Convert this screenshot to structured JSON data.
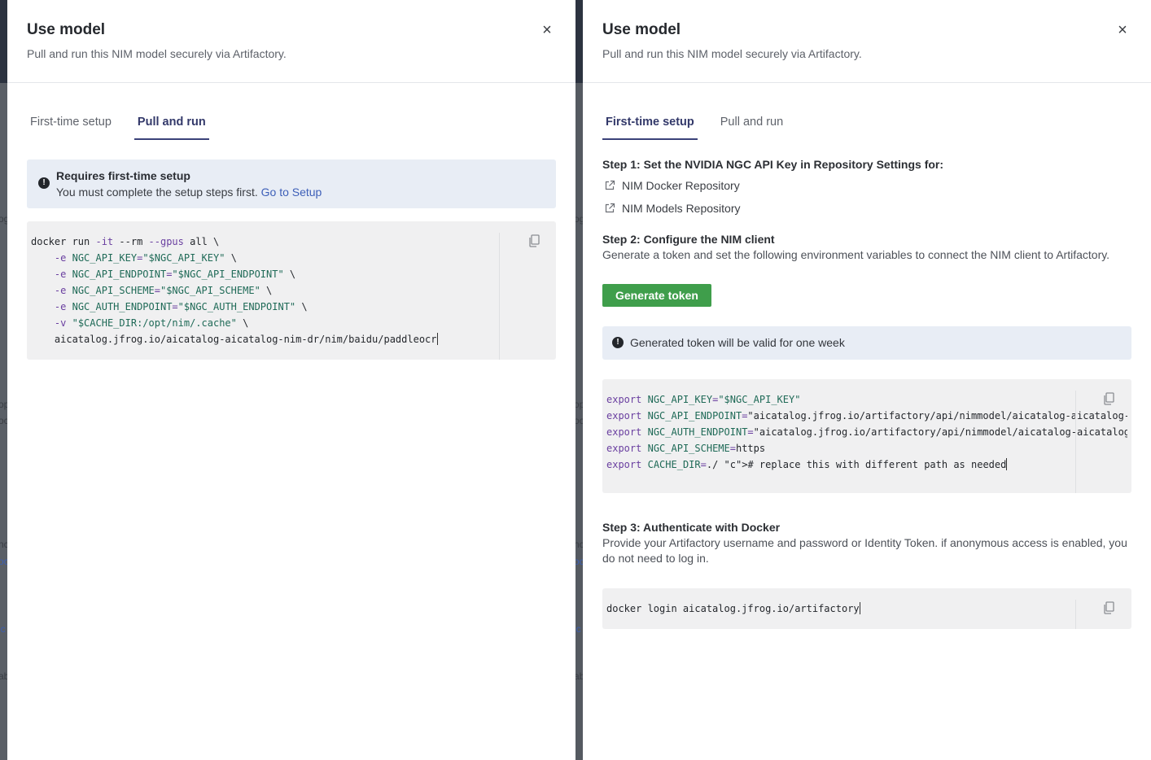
{
  "backdrop": {
    "left_fragments": [
      "og",
      "op",
      "oc",
      "nc",
      "oc",
      "ic",
      "ab"
    ],
    "mid_fragments": [
      "og",
      "op",
      "oc",
      "nc",
      "oc",
      "ic",
      "ab"
    ]
  },
  "left_panel": {
    "title": "Use model",
    "subtitle": "Pull and run this NIM model securely via Artifactory.",
    "tabs": [
      {
        "label": "First-time setup",
        "active": false
      },
      {
        "label": "Pull and run",
        "active": true
      }
    ],
    "alert": {
      "title": "Requires first-time setup",
      "text": "You must complete the setup steps first.",
      "link": "Go to Setup"
    },
    "code_lines": [
      "docker run -it --rm --gpus all \\",
      "    -e NGC_API_KEY=\"$NGC_API_KEY\" \\",
      "    -e NGC_API_ENDPOINT=\"$NGC_API_ENDPOINT\" \\",
      "    -e NGC_API_SCHEME=\"$NGC_API_SCHEME\" \\",
      "    -e NGC_AUTH_ENDPOINT=\"$NGC_AUTH_ENDPOINT\" \\",
      "    -v \"$CACHE_DIR:/opt/nim/.cache\" \\",
      "    aicatalog.jfrog.io/aicatalog-aicatalog-nim-dr/nim/baidu/paddleocr"
    ]
  },
  "right_panel": {
    "title": "Use model",
    "subtitle": "Pull and run this NIM model securely via Artifactory.",
    "tabs": [
      {
        "label": "First-time setup",
        "active": true
      },
      {
        "label": "Pull and run",
        "active": false
      }
    ],
    "step1": {
      "title": "Step 1: Set the NVIDIA NGC API Key in Repository Settings for:",
      "links": [
        "NIM Docker Repository",
        "NIM Models Repository"
      ]
    },
    "step2": {
      "title": "Step 2: Configure the NIM client",
      "text": "Generate a token and set the following environment variables to connect the NIM client to Artifactory.",
      "button": "Generate token",
      "alert": "Generated token will be valid for one week",
      "code_lines": [
        "export NGC_API_KEY=\"$NGC_API_KEY\"",
        "export NGC_API_ENDPOINT=\"aicatalog.jfrog.io/artifactory/api/nimmodel/aicatalog-aicatalog-r",
        "export NGC_AUTH_ENDPOINT=\"aicatalog.jfrog.io/artifactory/api/nimmodel/aicatalog-aicatalog-",
        "export NGC_API_SCHEME=https",
        "export CACHE_DIR=./ # replace this with different path as needed"
      ]
    },
    "step3": {
      "title": "Step 3: Authenticate with Docker",
      "text": "Provide your Artifactory username and password or Identity Token. if anonymous access is enabled, you do not need to log in.",
      "code": "docker login aicatalog.jfrog.io/artifactory"
    }
  },
  "icons": {
    "close": "close-icon",
    "copy": "copy-icon",
    "info": "info-icon",
    "external": "external-link-icon"
  },
  "colors": {
    "accent_tab": "#3b4279",
    "link": "#3d5fb8",
    "button_green": "#3f9e4b",
    "alert_bg": "#e8edf5",
    "code_bg": "#f0f0f1"
  }
}
